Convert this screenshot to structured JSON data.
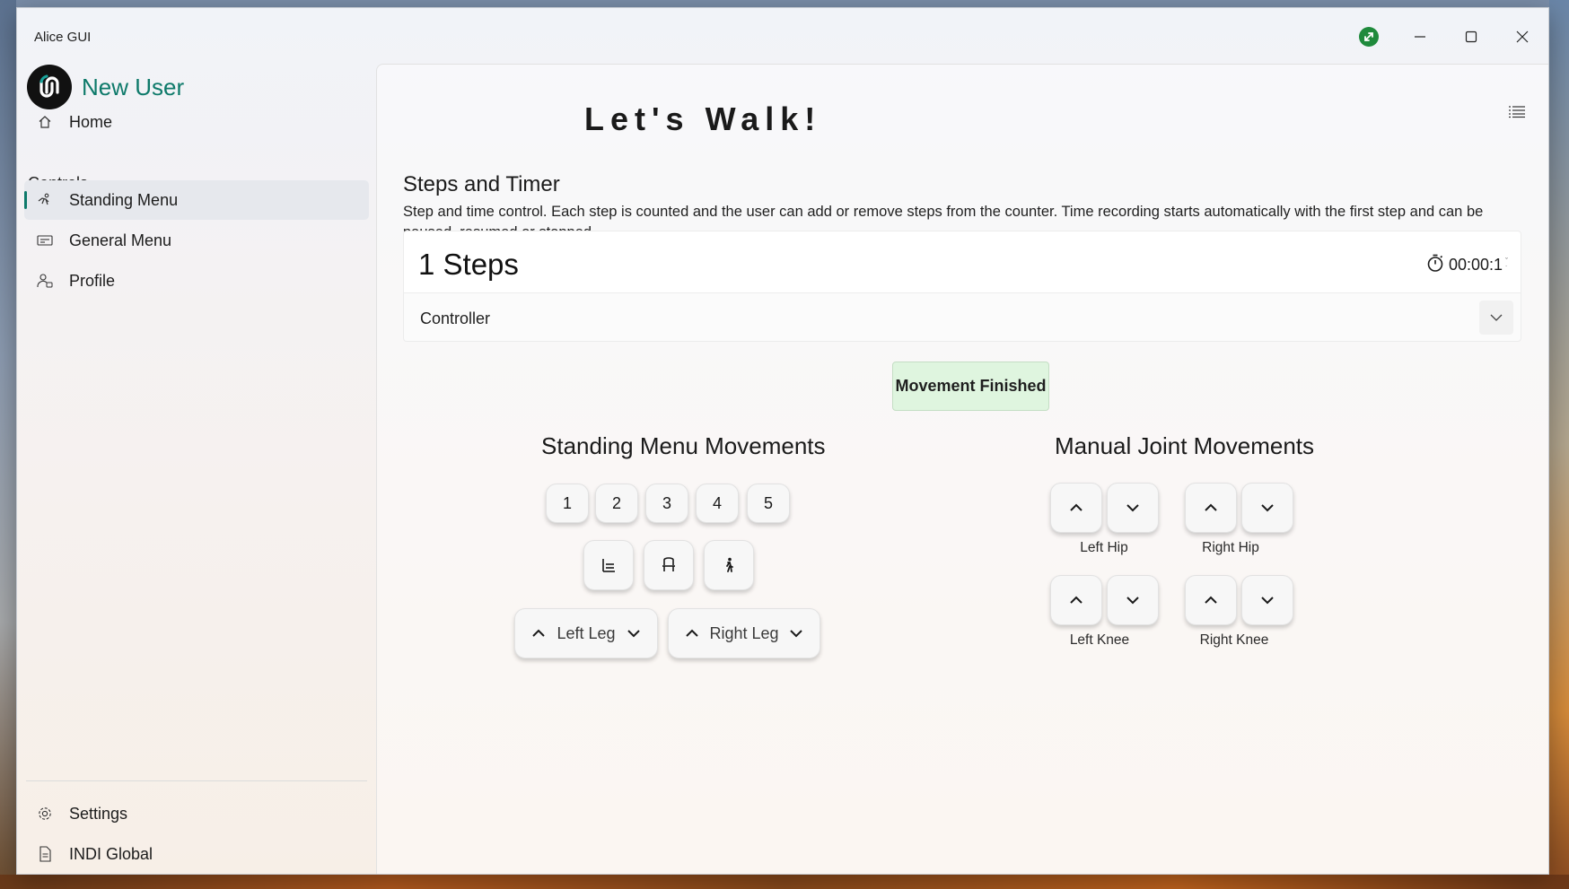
{
  "window": {
    "title": "Alice GUI"
  },
  "sidebar": {
    "user_name": "New User",
    "home": "Home",
    "section": "Controls",
    "items": [
      {
        "label": "Standing Menu",
        "icon": "standing-icon",
        "active": true
      },
      {
        "label": "General Menu",
        "icon": "menu-card-icon",
        "active": false
      },
      {
        "label": "Profile",
        "icon": "profile-icon",
        "active": false
      }
    ],
    "footer": [
      {
        "label": "Settings",
        "icon": "gear-icon"
      },
      {
        "label": "INDI Global",
        "icon": "document-icon"
      }
    ]
  },
  "main": {
    "title": "Let's Walk!",
    "section_title": "Steps and Timer",
    "section_desc": "Step and time control. Each step is counted and the user can add or remove steps from the counter. Time recording starts automatically with the first step and can be paused, resumed or stopped.",
    "steps_text": "1 Steps",
    "timer": "00:00:1",
    "controller_label": "Controller",
    "status": "Movement Finished",
    "standing": {
      "title": "Standing Menu Movements",
      "numbers": [
        "1",
        "2",
        "3",
        "4",
        "5"
      ],
      "left_leg": "Left Leg",
      "right_leg": "Right Leg"
    },
    "manual": {
      "title": "Manual Joint Movements",
      "left_hip": "Left Hip",
      "right_hip": "Right Hip",
      "left_knee": "Left Knee",
      "right_knee": "Right Knee"
    }
  },
  "colors": {
    "accent": "#0e7a6a",
    "status_bg": "#dff5df",
    "online": "#1f8a3c"
  }
}
